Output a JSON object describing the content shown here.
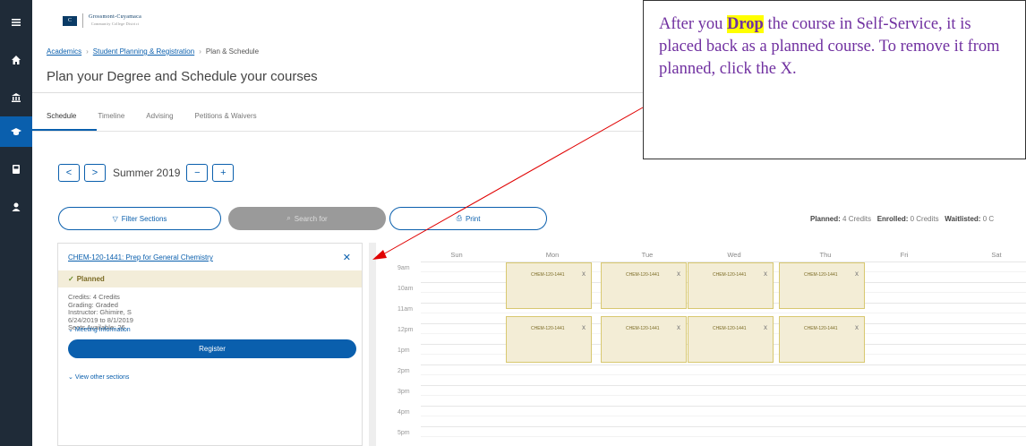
{
  "logo": {
    "mark": "C",
    "name": "Grossmont-Cuyamaca",
    "sub": "Community College District"
  },
  "breadcrumb": {
    "item1": "Academics",
    "item2": "Student Planning & Registration",
    "item3": "Plan & Schedule"
  },
  "page_title": "Plan your Degree and Schedule your courses",
  "tabs": [
    "Schedule",
    "Timeline",
    "Advising",
    "Petitions & Waivers"
  ],
  "term": {
    "prev": "<",
    "next": ">",
    "label": "Summer 2019",
    "remove": "−",
    "add": "+"
  },
  "actions": {
    "filter": "Filter Sections",
    "search": "Search for",
    "print": "Print"
  },
  "credits": {
    "planned_label": "Planned:",
    "planned_value": "4 Credits",
    "enrolled_label": "Enrolled:",
    "enrolled_value": "0 Credits",
    "waitlisted_label": "Waitlisted:",
    "waitlisted_value": "0 C"
  },
  "course": {
    "title": "CHEM-120-1441: Prep for General Chemistry",
    "close": "✕",
    "status": "Planned",
    "credits": "Credits: 4 Credits",
    "grading": "Grading: Graded",
    "instructor": "Instructor: Ghimire, S",
    "dates": "6/24/2019 to 8/1/2019",
    "seats": "Seats Available: 26",
    "meeting_info": "Meeting Information",
    "register": "Register",
    "view_other": "View other sections"
  },
  "calendar": {
    "days": [
      "Sun",
      "Mon",
      "Tue",
      "Wed",
      "Thu",
      "Fri",
      "Sat"
    ],
    "times": [
      "9am",
      "10am",
      "11am",
      "12pm",
      "1pm",
      "2pm",
      "3pm",
      "4pm",
      "5pm",
      "6pm"
    ],
    "event_label": "CHEM-120-1441",
    "event_close": "x"
  },
  "callout": {
    "before": "After you ",
    "highlight": "Drop",
    "after": " the course in Self-Service, it is placed back as a planned course. To remove it from planned, click the X."
  },
  "colors": {
    "accent": "#0a5fad",
    "nav": "#1f2b38",
    "planned": "#f3edd6",
    "callout_text": "#7030a0",
    "arrow": "#e00000"
  }
}
